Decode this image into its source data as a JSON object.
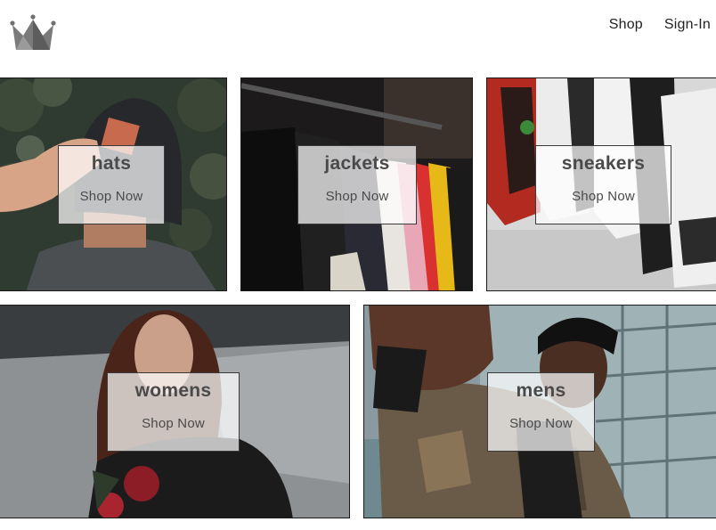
{
  "header": {
    "logo_icon": "crown-icon",
    "nav": {
      "shop_label": "Shop",
      "signin_label": "Sign-In"
    }
  },
  "directory": [
    {
      "title": "hats",
      "cta": "Shop Now"
    },
    {
      "title": "jackets",
      "cta": "Shop Now"
    },
    {
      "title": "sneakers",
      "cta": "Shop Now"
    },
    {
      "title": "womens",
      "cta": "Shop Now"
    },
    {
      "title": "mens",
      "cta": "Shop Now"
    }
  ]
}
